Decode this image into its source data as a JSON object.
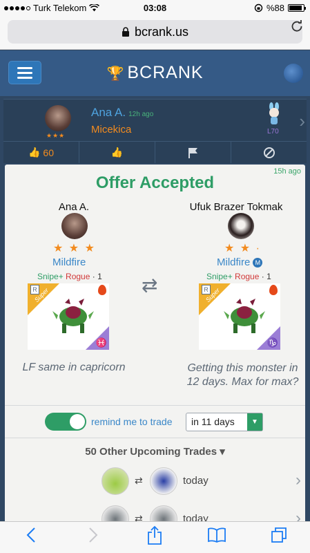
{
  "status_bar": {
    "carrier": "Turk Telekom",
    "time": "03:08",
    "battery": "%88",
    "battery_level": 0.88,
    "icons": [
      "wifi-icon",
      "rotation-lock-icon",
      "battery-icon"
    ]
  },
  "browser": {
    "url": "bcrank.us",
    "lock_icon": "lock-icon",
    "reload_icon": "reload-icon"
  },
  "navbar": {
    "brand": "BCRANK",
    "menu_icon": "hamburger-icon",
    "globe_icon": "globe-icon"
  },
  "trade_header": {
    "user_name": "Ana A.",
    "time_ago": "12h ago",
    "monster_name": "Micekica",
    "level": "L70",
    "stars": "★★★"
  },
  "actions": {
    "like_count": "60"
  },
  "offer": {
    "time_ago": "15h ago",
    "title": "Offer Accepted",
    "left": {
      "user_name": "Ana A.",
      "stars": "★ ★ ★",
      "monster_name": "Mildfire",
      "trait_1": "Snipe+",
      "trait_2": "Rogue",
      "trait_level": "· 1",
      "ribbon": "Super",
      "rank_badge": "R",
      "zodiac": "♓",
      "description": "LF same in capricorn"
    },
    "right": {
      "user_name": "Ufuk Brazer Tokmak",
      "stars": "★ ★ ·",
      "monster_name": "Mildfire",
      "badge": "M",
      "trait_1": "Snipe+",
      "trait_2": "Rogue",
      "trait_level": "· 1",
      "ribbon": "Super",
      "rank_badge": "R",
      "zodiac": "♑",
      "description": "Getting this monster in 12 days. Max for max?"
    }
  },
  "reminder": {
    "enabled": true,
    "label": "remind me to trade",
    "selected_option": "in 11 days"
  },
  "upcoming": {
    "title": "50 Other Upcoming Trades ▾",
    "rows": [
      {
        "date": "today"
      },
      {
        "date": "today"
      }
    ]
  },
  "toolbar": {
    "buttons": [
      "back-icon",
      "forward-icon",
      "share-icon",
      "bookmarks-icon",
      "tabs-icon"
    ]
  }
}
